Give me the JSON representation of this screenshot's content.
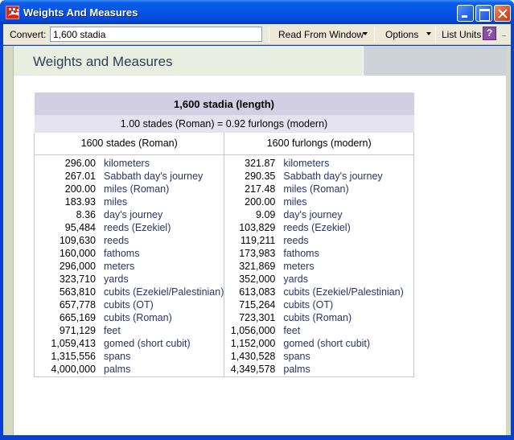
{
  "window": {
    "title": "Weights And Measures",
    "icon": "app-logo-icon",
    "controls": [
      "minimize",
      "maximize",
      "close"
    ]
  },
  "toolbar": {
    "convert_label": "Convert:",
    "convert_value": "1,600 stadia",
    "read_from_window_label": "Read From Window",
    "options_label": "Options",
    "list_units_label": "List Units",
    "help_label": "?"
  },
  "page": {
    "title": "Weights and Measures"
  },
  "table": {
    "heading": "1,600 stadia (length)",
    "equivalence": "1.00 stades (Roman) = 0.92 furlongs (modern)",
    "columns": [
      {
        "header": "1600 stades (Roman)",
        "rows": [
          {
            "value": "296.00",
            "unit": "kilometers"
          },
          {
            "value": "267.01",
            "unit": "Sabbath day's journey"
          },
          {
            "value": "200.00",
            "unit": "miles (Roman)"
          },
          {
            "value": "183.93",
            "unit": "miles"
          },
          {
            "value": "8.36",
            "unit": "day's journey"
          },
          {
            "value": "95,484",
            "unit": "reeds (Ezekiel)"
          },
          {
            "value": "109,630",
            "unit": "reeds"
          },
          {
            "value": "160,000",
            "unit": "fathoms"
          },
          {
            "value": "296,000",
            "unit": "meters"
          },
          {
            "value": "323,710",
            "unit": "yards"
          },
          {
            "value": "563,810",
            "unit": "cubits (Ezekiel/Palestinian)"
          },
          {
            "value": "657,778",
            "unit": "cubits (OT)"
          },
          {
            "value": "665,169",
            "unit": "cubits (Roman)"
          },
          {
            "value": "971,129",
            "unit": "feet"
          },
          {
            "value": "1,059,413",
            "unit": "gomed (short cubit)"
          },
          {
            "value": "1,315,556",
            "unit": "spans"
          },
          {
            "value": "4,000,000",
            "unit": "palms"
          }
        ]
      },
      {
        "header": "1600 furlongs (modern)",
        "rows": [
          {
            "value": "321.87",
            "unit": "kilometers"
          },
          {
            "value": "290.35",
            "unit": "Sabbath day's journey"
          },
          {
            "value": "217.48",
            "unit": "miles (Roman)"
          },
          {
            "value": "200.00",
            "unit": "miles"
          },
          {
            "value": "9.09",
            "unit": "day's journey"
          },
          {
            "value": "103,829",
            "unit": "reeds (Ezekiel)"
          },
          {
            "value": "119,211",
            "unit": "reeds"
          },
          {
            "value": "173,983",
            "unit": "fathoms"
          },
          {
            "value": "321,869",
            "unit": "meters"
          },
          {
            "value": "352,000",
            "unit": "yards"
          },
          {
            "value": "613,083",
            "unit": "cubits (Ezekiel/Palestinian)"
          },
          {
            "value": "715,264",
            "unit": "cubits (OT)"
          },
          {
            "value": "723,301",
            "unit": "cubits (Roman)"
          },
          {
            "value": "1,056,000",
            "unit": "feet"
          },
          {
            "value": "1,152,000",
            "unit": "gomed (short cubit)"
          },
          {
            "value": "1,430,528",
            "unit": "spans"
          },
          {
            "value": "4,349,578",
            "unit": "palms"
          }
        ]
      }
    ]
  }
}
